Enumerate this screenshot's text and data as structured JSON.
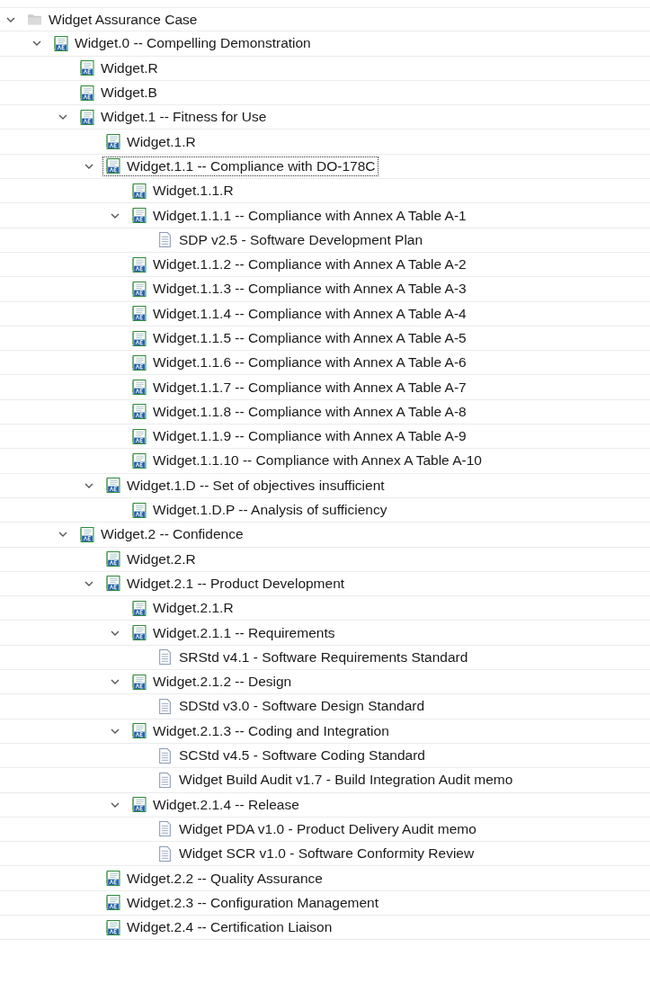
{
  "tree": [
    {
      "label": "Widget Assurance Case",
      "kind": "folder",
      "expanded": true,
      "selected": false,
      "children": [
        {
          "label": "Widget.0 -- Compelling Demonstration",
          "kind": "case",
          "expanded": true,
          "selected": false,
          "children": [
            {
              "label": "Widget.R",
              "kind": "case",
              "selected": false
            },
            {
              "label": "Widget.B",
              "kind": "case",
              "selected": false
            },
            {
              "label": "Widget.1 -- Fitness for Use",
              "kind": "case",
              "expanded": true,
              "selected": false,
              "children": [
                {
                  "label": "Widget.1.R",
                  "kind": "case",
                  "selected": false
                },
                {
                  "label": "Widget.1.1 -- Compliance with DO-178C",
                  "kind": "case",
                  "expanded": true,
                  "selected": true,
                  "children": [
                    {
                      "label": "Widget.1.1.R",
                      "kind": "case",
                      "selected": false
                    },
                    {
                      "label": "Widget.1.1.1 -- Compliance with Annex A Table A-1",
                      "kind": "case",
                      "expanded": true,
                      "selected": false,
                      "children": [
                        {
                          "label": "SDP v2.5 - Software Development Plan",
                          "kind": "doc",
                          "selected": false
                        }
                      ]
                    },
                    {
                      "label": "Widget.1.1.2 -- Compliance with Annex A Table A-2",
                      "kind": "case",
                      "selected": false
                    },
                    {
                      "label": "Widget.1.1.3 -- Compliance with Annex A Table A-3",
                      "kind": "case",
                      "selected": false
                    },
                    {
                      "label": "Widget.1.1.4 -- Compliance with Annex A Table A-4",
                      "kind": "case",
                      "selected": false
                    },
                    {
                      "label": "Widget.1.1.5 -- Compliance with Annex A Table A-5",
                      "kind": "case",
                      "selected": false
                    },
                    {
                      "label": "Widget.1.1.6 -- Compliance with Annex A Table A-6",
                      "kind": "case",
                      "selected": false
                    },
                    {
                      "label": "Widget.1.1.7 -- Compliance with Annex A Table A-7",
                      "kind": "case",
                      "selected": false
                    },
                    {
                      "label": "Widget.1.1.8 -- Compliance with Annex A Table A-8",
                      "kind": "case",
                      "selected": false
                    },
                    {
                      "label": "Widget.1.1.9 -- Compliance with Annex A Table A-9",
                      "kind": "case",
                      "selected": false
                    },
                    {
                      "label": "Widget.1.1.10 -- Compliance with Annex A Table A-10",
                      "kind": "case",
                      "selected": false
                    }
                  ]
                },
                {
                  "label": "Widget.1.D -- Set of objectives insufficient",
                  "kind": "case",
                  "expanded": true,
                  "selected": false,
                  "children": [
                    {
                      "label": "Widget.1.D.P -- Analysis of sufficiency",
                      "kind": "case",
                      "selected": false
                    }
                  ]
                }
              ]
            },
            {
              "label": "Widget.2 -- Confidence",
              "kind": "case",
              "expanded": true,
              "selected": false,
              "children": [
                {
                  "label": "Widget.2.R",
                  "kind": "case",
                  "selected": false
                },
                {
                  "label": "Widget.2.1 -- Product Development",
                  "kind": "case",
                  "expanded": true,
                  "selected": false,
                  "children": [
                    {
                      "label": "Widget.2.1.R",
                      "kind": "case",
                      "selected": false
                    },
                    {
                      "label": "Widget.2.1.1 -- Requirements",
                      "kind": "case",
                      "expanded": true,
                      "selected": false,
                      "children": [
                        {
                          "label": "SRStd v4.1 - Software Requirements Standard",
                          "kind": "doc",
                          "selected": false
                        }
                      ]
                    },
                    {
                      "label": "Widget.2.1.2 -- Design",
                      "kind": "case",
                      "expanded": true,
                      "selected": false,
                      "children": [
                        {
                          "label": "SDStd v3.0 - Software Design Standard",
                          "kind": "doc",
                          "selected": false
                        }
                      ]
                    },
                    {
                      "label": "Widget.2.1.3 -- Coding and Integration",
                      "kind": "case",
                      "expanded": true,
                      "selected": false,
                      "children": [
                        {
                          "label": "SCStd v4.5 - Software Coding Standard",
                          "kind": "doc",
                          "selected": false
                        },
                        {
                          "label": "Widget Build Audit v1.7 - Build Integration Audit memo",
                          "kind": "doc",
                          "selected": false
                        }
                      ]
                    },
                    {
                      "label": "Widget.2.1.4 -- Release",
                      "kind": "case",
                      "expanded": true,
                      "selected": false,
                      "children": [
                        {
                          "label": "Widget PDA v1.0 - Product Delivery Audit memo",
                          "kind": "doc",
                          "selected": false
                        },
                        {
                          "label": "Widget SCR v1.0 - Software Conformity Review",
                          "kind": "doc",
                          "selected": false
                        }
                      ]
                    }
                  ]
                },
                {
                  "label": "Widget.2.2 -- Quality Assurance",
                  "kind": "case",
                  "selected": false
                },
                {
                  "label": "Widget.2.3 -- Configuration Management",
                  "kind": "case",
                  "selected": false
                },
                {
                  "label": "Widget.2.4 -- Certification Liaison",
                  "kind": "case",
                  "selected": false
                }
              ]
            }
          ]
        }
      ]
    }
  ]
}
